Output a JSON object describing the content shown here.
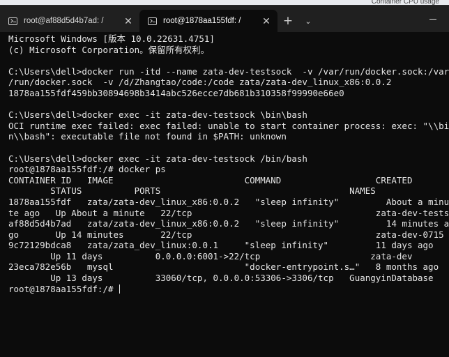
{
  "background_hint": {
    "label": "Container CPU usage"
  },
  "tabs": [
    {
      "title": "root@af88d5d4b7ad: /",
      "close": "✕",
      "active": false
    },
    {
      "title": "root@1878aa155fdf: /",
      "close": "✕",
      "active": true
    }
  ],
  "tab_controls": {
    "new_tab": "+",
    "dropdown": "⌄"
  },
  "window_controls": {
    "close": "✕"
  },
  "terminal": {
    "lines": [
      "Microsoft Windows [版本 10.0.22631.4751]",
      "(c) Microsoft Corporation。保留所有权利。",
      "",
      "C:\\Users\\dell>docker run -itd --name zata-dev-testsock  -v /var/run/docker.sock:/var",
      "/run/docker.sock  -v /d/Zhangtao/code:/code zata/zata-dev_linux_x86:0.0.2",
      "1878aa155fdf459bb30894698b3414abc526ecce7db681b310358f99990e66e0",
      "",
      "C:\\Users\\dell>docker exec -it zata-dev-testsock \\bin\\bash",
      "OCI runtime exec failed: exec failed: unable to start container process: exec: \"\\\\bi",
      "n\\\\bash\": executable file not found in $PATH: unknown",
      "",
      "C:\\Users\\dell>docker exec -it zata-dev-testsock /bin/bash",
      "root@1878aa155fdf:/# docker ps",
      "CONTAINER ID   IMAGE                         COMMAND                  CREATED",
      "        STATUS          PORTS                                    NAMES",
      "1878aa155fdf   zata/zata-dev_linux_x86:0.0.2   \"sleep infinity\"         About a minu",
      "te ago   Up About a minute   22/tcp                                   zata-dev-testsock",
      "af88d5d4b7ad   zata/zata-dev_linux_x86:0.0.2   \"sleep infinity\"         14 minutes a",
      "go       Up 14 minutes       22/tcp                                   zata-dev-0715",
      "9c72129bdca8   zata/zata_dev_linux:0.0.1     \"sleep infinity\"         11 days ago",
      "        Up 11 days          0.0.0.0:6001->22/tcp                     zata-dev",
      "23eca782e56b   mysql                         \"docker-entrypoint.s…\"   8 months ago",
      "        Up 13 days          33060/tcp, 0.0.0.0:53306->3306/tcp   GuangyinDatabase",
      "root@1878aa155fdf:/# "
    ]
  }
}
